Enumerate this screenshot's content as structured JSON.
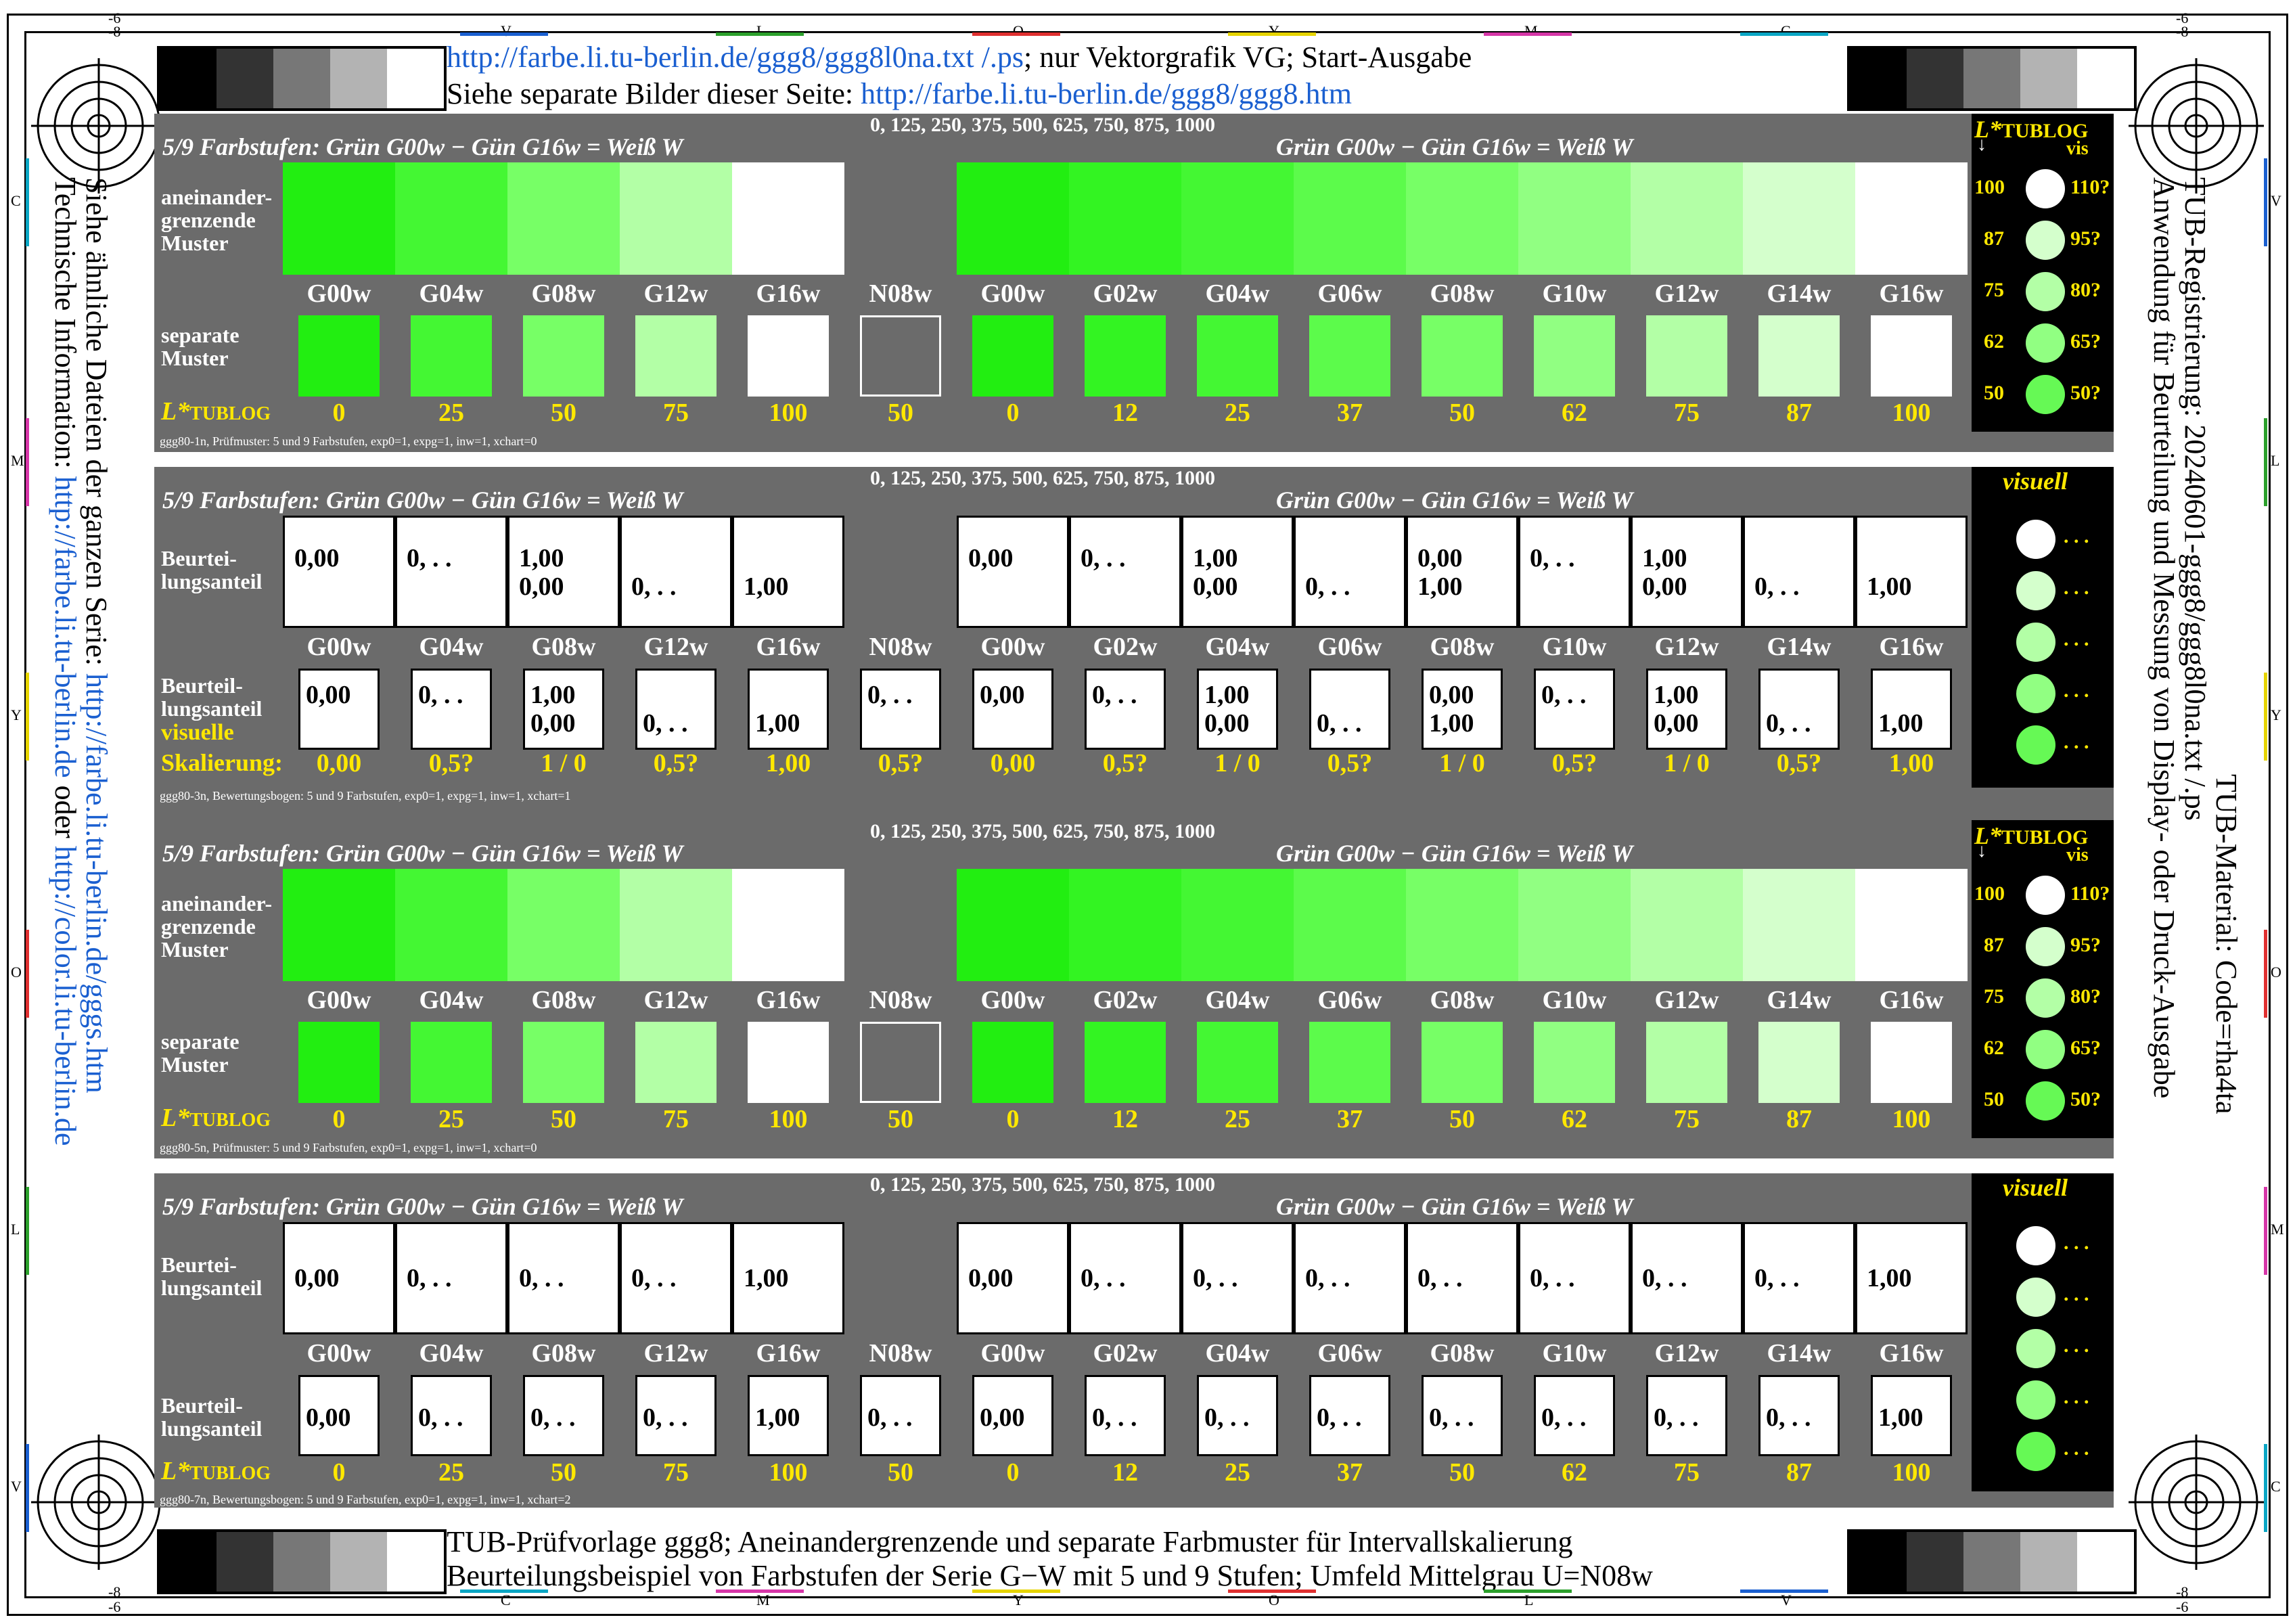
{
  "header": {
    "line1_link": "http://farbe.li.tu-berlin.de/ggg8/ggg8l0na.txt /.ps",
    "line1_text": "; nur Vektorgrafik VG; Start-Ausgabe",
    "line2_text": "Siehe separate Bilder dieser Seite: ",
    "line2_link": "http://farbe.li.tu-berlin.de/ggg8/ggg8.htm"
  },
  "footer": {
    "line1": "TUB-Prüfvorlage ggg8; Aneinandergrenzende und separate Farbmuster für Intervallskalierung",
    "line2": "Beurteilungsbeispiel von Farbstufen der Serie G−W mit 5 und 9 Stufen; Umfeld Mittelgrau U=N08w"
  },
  "left_side": {
    "line1": "Siehe ähnliche Dateien der ganzen Serie: ",
    "line1_link": "http://farbe.li.tu-berlin.de/gggs.htm",
    "line2": "Technische Information: ",
    "line2_link": "http://farbe.li.tu-berlin.de",
    "line2_mid": " oder ",
    "line2_link2": "http://color.li.tu-berlin.de"
  },
  "right_side": {
    "line1": "TUB-Registrierung: 20240601-ggg8/ggg8l0na.txt /.ps",
    "line2": "Anwendung für Beurteilung und Messung von Display- oder Druck-Ausgabe",
    "line3": "TUB-Material: Code=rha4ta"
  },
  "edge_labels": {
    "top": [
      "V",
      "L",
      "O",
      "Y",
      "M",
      "C"
    ],
    "bottom": [
      "C",
      "M",
      "Y",
      "O",
      "L",
      "V"
    ],
    "left": [
      "C",
      "M",
      "Y",
      "O",
      "L",
      "V"
    ],
    "right": [
      "V",
      "L",
      "Y",
      "O",
      "M",
      "C"
    ],
    "corner_top": "-8",
    "corner_top2": "-6",
    "corner_bottom": "-8",
    "corner_bottom2": "-6"
  },
  "panel_common": {
    "title_left": "5/9 Farbstufen:  Grün G00w − Gün G16w = Weiß W",
    "title_right": "Grün G00w − Gün G16w = Weiß W",
    "values": "0, 125, 250, 375, 500, 625, 750, 875, 1000",
    "codes": [
      "G00w",
      "G04w",
      "G08w",
      "G12w",
      "G16w",
      "N08w",
      "G00w",
      "G02w",
      "G04w",
      "G06w",
      "G08w",
      "G10w",
      "G12w",
      "G14w",
      "G16w"
    ],
    "lvalues": [
      "0",
      "25",
      "50",
      "75",
      "100",
      "50",
      "0",
      "12",
      "25",
      "37",
      "50",
      "62",
      "75",
      "87",
      "100"
    ],
    "label_adjacent": "aneinander-\ngrenzende\nMuster",
    "label_separate": "separate\nMuster",
    "label_judge": "Beurtei-\nlungsanteil",
    "label_judge2": "Beurteil-\nlungsanteil",
    "label_visuelle": "visuelle",
    "label_skal": "Skalierung:",
    "lstar": "L*",
    "tublog": "TUBLOG",
    "vis": "vis",
    "visuell": "visuell"
  },
  "colors": {
    "strip": [
      "#22ee11",
      "#44f733",
      "#77ff66",
      "#b3ffa6",
      "#ffffff",
      "#6b6b6b",
      "#22ee11",
      "#33f422",
      "#44f733",
      "#5cfb4b",
      "#77ff66",
      "#91ff82",
      "#b3ffa6",
      "#d4ffcc",
      "#ffffff"
    ],
    "circles": [
      "#ffffff",
      "#d4ffcc",
      "#b3ffa6",
      "#91ff82",
      "#66f955"
    ]
  },
  "side_scale": {
    "left": [
      "100",
      "87",
      "75",
      "62",
      "50"
    ],
    "right": [
      "110?",
      "95?",
      "80?",
      "65?",
      "50?"
    ]
  },
  "panel1": {
    "footer": "ggg80-1n, Prüfmuster: 5 und 9 Farbstufen, exp0=1, expg=1, inw=1, xchart=0"
  },
  "panel2": {
    "footer": "ggg80-3n, Bewertungsbogen: 5 und 9 Farbstufen, exp0=1, expg=1, inw=1, xchart=1",
    "top_cells": [
      [
        "0,00",
        ""
      ],
      [
        "0, . .",
        ""
      ],
      [
        "1,00",
        "0,00"
      ],
      [
        "",
        "0, . ."
      ],
      [
        "",
        "1,00"
      ],
      null,
      [
        "0,00",
        ""
      ],
      [
        "0, . .",
        ""
      ],
      [
        "1,00",
        "0,00"
      ],
      [
        "",
        "0, . ."
      ],
      [
        "0,00",
        "1,00"
      ],
      [
        "0, . .",
        ""
      ],
      [
        "1,00",
        "0,00"
      ],
      [
        "",
        "0, . ."
      ],
      [
        "",
        "1,00"
      ]
    ],
    "bottom_cells": [
      [
        "0,00",
        ""
      ],
      [
        "0, . .",
        ""
      ],
      [
        "1,00",
        "0,00"
      ],
      [
        "",
        "0, . ."
      ],
      [
        "",
        "1,00"
      ],
      [
        "0, . .",
        ""
      ],
      [
        "0,00",
        ""
      ],
      [
        "0, . .",
        ""
      ],
      [
        "1,00",
        "0,00"
      ],
      [
        "",
        "0, . ."
      ],
      [
        "0,00",
        "1,00"
      ],
      [
        "0, . .",
        ""
      ],
      [
        "1,00",
        "0,00"
      ],
      [
        "",
        "0, . ."
      ],
      [
        "",
        "1,00"
      ]
    ],
    "skal": [
      "0,00",
      "0,5?",
      "1 / 0",
      "0,5?",
      "1,00",
      "0,5?",
      "0,00",
      "0,5?",
      "1 / 0",
      "0,5?",
      "1 / 0",
      "0,5?",
      "1 / 0",
      "0,5?",
      "1,00"
    ],
    "dots": ". . ."
  },
  "panel3": {
    "footer": "ggg80-5n, Prüfmuster: 5 und 9 Farbstufen, exp0=1, expg=1, inw=1, xchart=0"
  },
  "panel4": {
    "footer": "ggg80-7n, Bewertungsbogen: 5 und 9 Farbstufen, exp0=1, expg=1, inw=1, xchart=2",
    "top_cells": [
      "0,00",
      "0, . .",
      "0, . .",
      "0, . .",
      "1,00",
      null,
      "0,00",
      "0, . .",
      "0, . .",
      "0, . .",
      "0, . .",
      "0, . .",
      "0, . .",
      "0, . .",
      "1,00"
    ],
    "bottom_cells": [
      "0,00",
      "0, . .",
      "0, . .",
      "0, . .",
      "1,00",
      "0, . .",
      "0,00",
      "0, . .",
      "0, . .",
      "0, . .",
      "0, . .",
      "0, . .",
      "0, . .",
      "0, . .",
      "1,00"
    ],
    "dots": ". . ."
  }
}
